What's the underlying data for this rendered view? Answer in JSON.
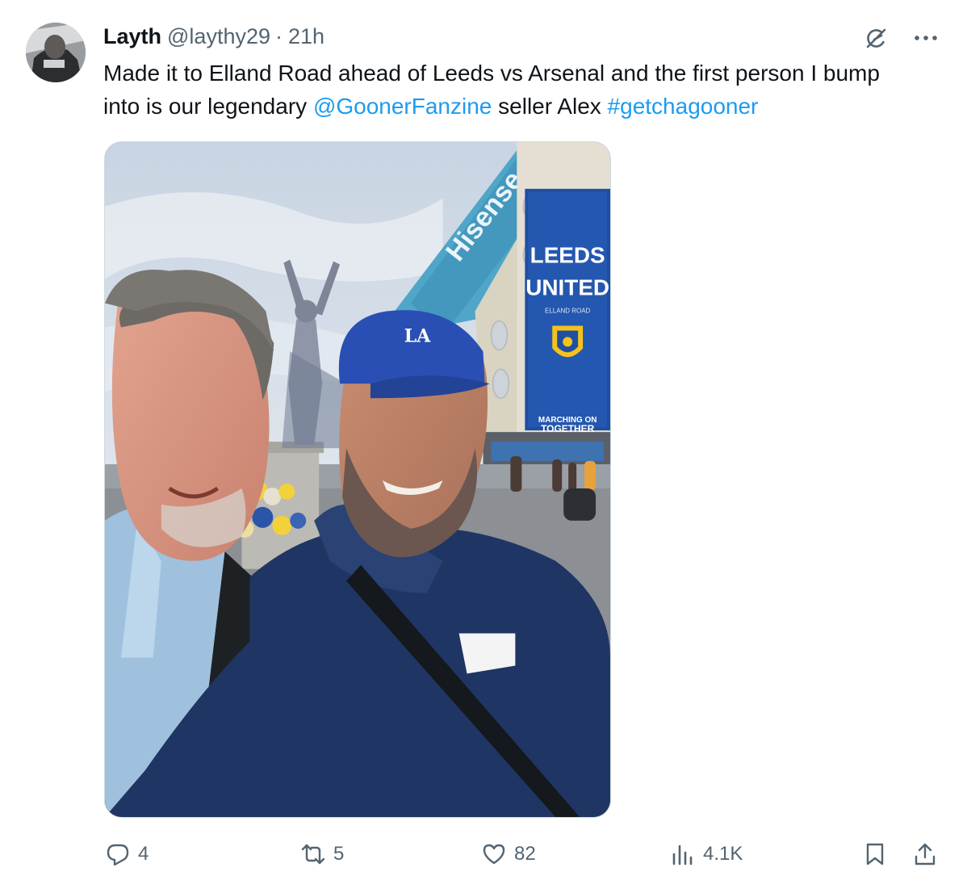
{
  "tweet": {
    "author": {
      "name": "Layth",
      "handle": "@laythy29",
      "separator": "·",
      "time": "21h"
    },
    "text_parts": [
      {
        "text": "Made it to Elland Road ahead of Leeds vs Arsenal and the first person I bump into is our legendary ",
        "type": "text"
      },
      {
        "text": "@GoonerFanzine",
        "type": "mention"
      },
      {
        "text": " seller Alex ",
        "type": "text"
      },
      {
        "text": "#getchagooner",
        "type": "hashtag"
      }
    ],
    "media": {
      "signage": {
        "sponsor": "Hisense",
        "club_line1": "LEEDS",
        "club_line2": "UNITED",
        "ground": "ELLAND ROAD",
        "motto_line1": "MARCHING ON",
        "motto_line2": "TOGETHER",
        "cap_logo": "LA"
      }
    },
    "actions": {
      "replies": "4",
      "reposts": "5",
      "likes": "82",
      "views": "4.1K"
    }
  },
  "icons": {
    "top_right": [
      "grok-icon",
      "more-icon"
    ],
    "bottom": [
      "reply-icon",
      "repost-icon",
      "like-icon",
      "views-icon",
      "bookmark-icon",
      "share-icon"
    ]
  },
  "colors": {
    "text_primary": "#0f1419",
    "text_secondary": "#536471",
    "link": "#1d9bf0",
    "border": "#cfd9de"
  }
}
